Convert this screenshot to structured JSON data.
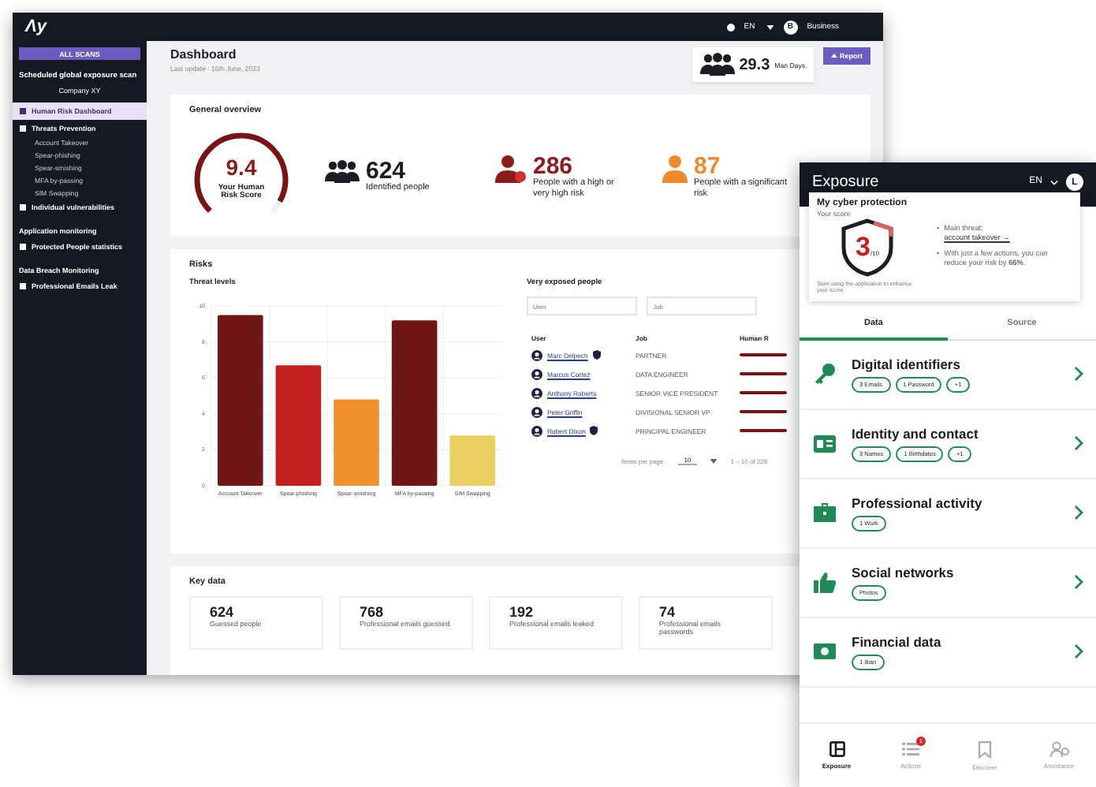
{
  "topbar": {
    "logo": "Λy",
    "language": "EN",
    "avatar_initial": "B",
    "account": "Business"
  },
  "sidebar": {
    "scan_button": "ALL SCANS",
    "scan_title": "Scheduled global exposure scan",
    "company": "Company XY",
    "items": [
      {
        "kind": "item",
        "label": "Human Risk Dashboard",
        "selected": true
      },
      {
        "kind": "item",
        "label": "Threats Prevention",
        "selected": false,
        "children": [
          {
            "label": "Account Takeover",
            "selected": false
          },
          {
            "label": "Spear-phishing",
            "selected": false
          },
          {
            "label": "Spear-smishing",
            "selected": false
          },
          {
            "label": "MFA by-passing",
            "selected": false
          },
          {
            "label": "SIM Swapping",
            "selected": false
          }
        ]
      },
      {
        "kind": "item",
        "label": "Individual vulnerabilities",
        "selected": false
      },
      {
        "kind": "heading",
        "label": "Application monitoring"
      },
      {
        "kind": "item",
        "label": "Protected People statistics",
        "selected": false
      },
      {
        "kind": "heading",
        "label": "Data Breach Monitoring"
      },
      {
        "kind": "item",
        "label": "Professional Emails Leak",
        "selected": false
      }
    ]
  },
  "header": {
    "title": "Dashboard",
    "last_update": "Last update : 16th June, 2023",
    "man_days": {
      "value": "29.3",
      "unit": "Man Days"
    },
    "report_button": "Report"
  },
  "overview": {
    "title": "General overview",
    "score": {
      "value": "9.4",
      "label": "Your Human Risk Score",
      "level": 0.94
    },
    "stats": [
      {
        "kind": "group",
        "value": "624",
        "label": "Identified people",
        "color": "#1c1c24"
      },
      {
        "kind": "alert",
        "value": "286",
        "label": "People with a high or very high risk",
        "color": "#8a1c1c"
      },
      {
        "kind": "person",
        "value": "87",
        "label": "People with a significant risk",
        "color": "#ef8a2a"
      }
    ]
  },
  "risks": {
    "title": "Risks",
    "threats": {
      "title": "Threat levels",
      "chart_data": {
        "type": "bar",
        "categories": [
          "Account Takeover",
          "Spear-phishing",
          "Spear-smishing",
          "MFA by-passing",
          "SIM Swapping"
        ],
        "series": [
          {
            "values": [
              9.5,
              6.7,
              4.8,
              9.2,
              2.8
            ]
          }
        ],
        "ylim": [
          0,
          10
        ],
        "yticks": [
          0,
          2,
          4,
          6,
          8,
          10
        ],
        "grid": true
      }
    },
    "people": {
      "title": "Very exposed people",
      "filters": [
        {
          "placeholder": "User"
        },
        {
          "placeholder": "Job"
        }
      ],
      "columns": [
        "User",
        "Job",
        "Human R"
      ],
      "rows": [
        {
          "user": "Marc Delpech",
          "job": "PARTNER",
          "protected": true
        },
        {
          "user": "Marcus Cortez",
          "job": "DATA ENGINEER",
          "protected": false
        },
        {
          "user": "Anthony Roberts",
          "job": "SENIOR VICE PRESIDENT",
          "protected": false
        },
        {
          "user": "Peter Griffin",
          "job": "DIVISIONAL SENIOR VP",
          "protected": false
        },
        {
          "user": "Robert Dixon",
          "job": "PRINCIPAL ENGINEER",
          "protected": true
        }
      ],
      "pagination": {
        "label": "Items per page:",
        "page_size": "10",
        "range": "1 – 10 of 228"
      }
    }
  },
  "key_data": {
    "title": "Key data",
    "cards": [
      {
        "value": "624",
        "label": "Guessed people"
      },
      {
        "value": "768",
        "label": "Professional emails guessed"
      },
      {
        "value": "192",
        "label": "Professional emails leaked"
      },
      {
        "value": "74",
        "label": "Professional emails passwords"
      }
    ]
  },
  "phone": {
    "title": "Exposure",
    "language": "EN",
    "avatar_initial": "L",
    "protection": {
      "title": "My cyber protection",
      "score_label": "Your score",
      "score": "3",
      "score_max": "/10",
      "hint": "Start using the application to enhance your score",
      "bullet": "•",
      "threat_label": "Main threat:",
      "threat_link": "account takeover →",
      "advice": "With just a few actions, you can reduce your risk by **66%**."
    },
    "tabs": [
      {
        "label": "Data",
        "selected": true
      },
      {
        "label": "Source",
        "selected": false
      }
    ],
    "categories": [
      {
        "kind": "identifiers",
        "title": "Digital identifiers",
        "tags": [
          "3 Emails",
          "1 Password",
          "+1"
        ]
      },
      {
        "kind": "identity",
        "title": "Identity and contact",
        "tags": [
          "3 Names",
          "1 Birthdates",
          "+1"
        ]
      },
      {
        "kind": "professional",
        "title": "Professional activity",
        "tags": [
          "1 Work"
        ]
      },
      {
        "kind": "social",
        "title": "Social networks",
        "tags": [
          "Photos"
        ]
      },
      {
        "kind": "financial",
        "title": "Financial data",
        "tags": [
          "1 Iban"
        ]
      }
    ],
    "nav": [
      {
        "kind": "exposure",
        "label": "Exposure",
        "selected": true
      },
      {
        "kind": "actions",
        "label": "Actions",
        "selected": false,
        "badge": "1"
      },
      {
        "kind": "discover",
        "label": "Discover",
        "selected": false
      },
      {
        "kind": "assistance",
        "label": "Assistance",
        "selected": false
      }
    ]
  }
}
